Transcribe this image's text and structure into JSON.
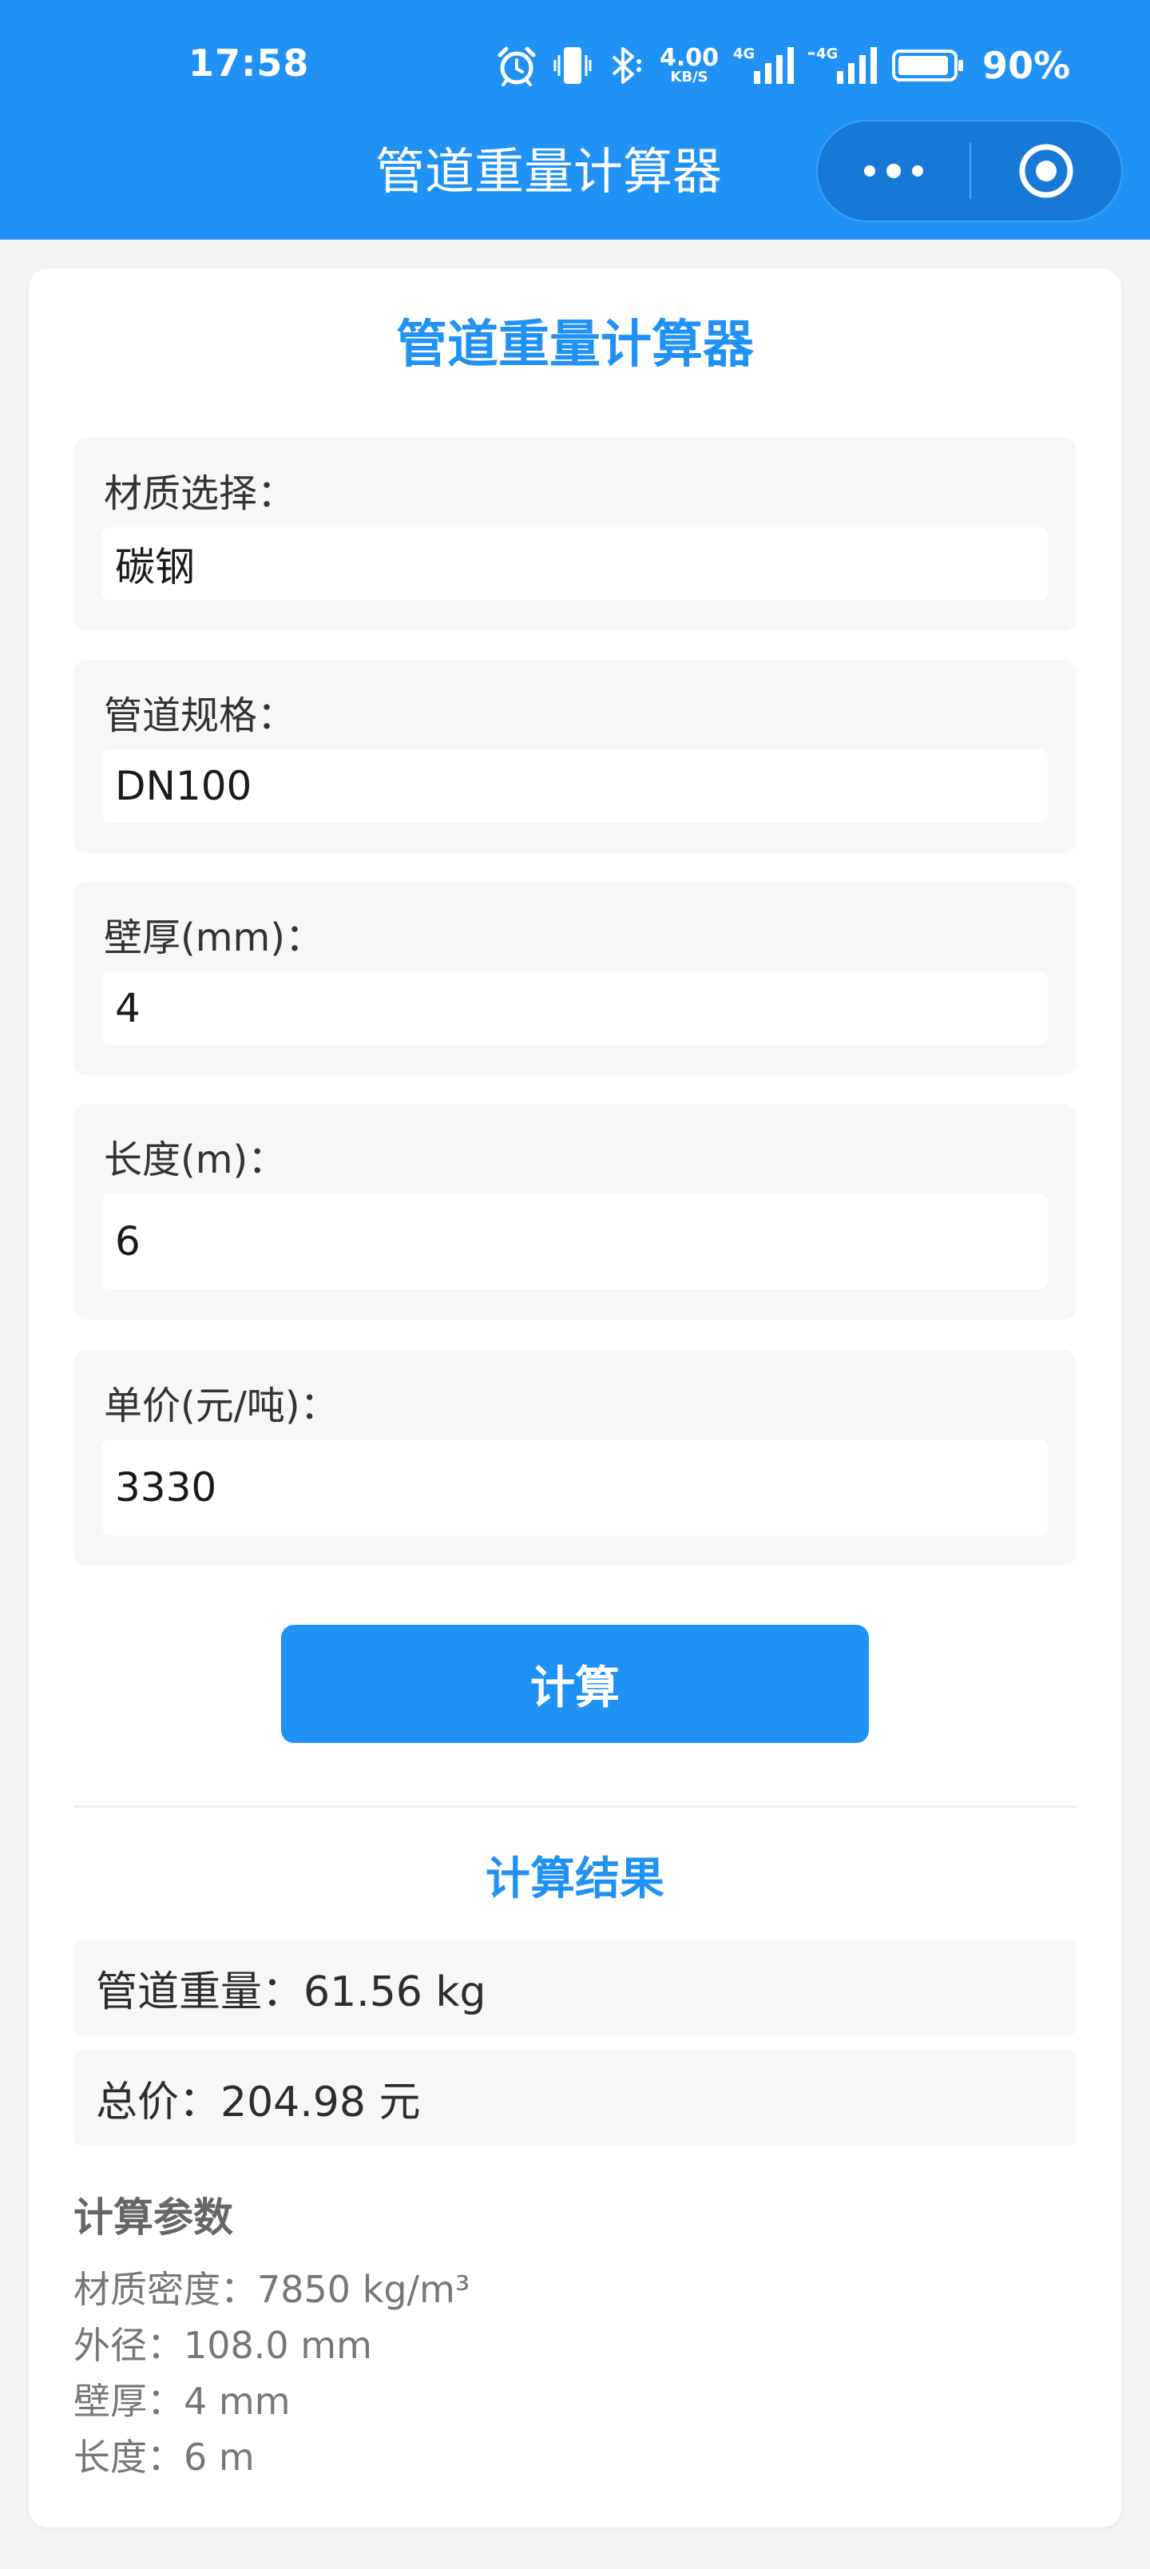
{
  "status_bar": {
    "time": "17:58",
    "net_speed_value": "4.00",
    "net_speed_unit": "KB/S",
    "signal1_label": "4G",
    "signal2_label": "4G",
    "battery": "90%"
  },
  "nav": {
    "title": "管道重量计算器",
    "more_icon": "more-dots-icon",
    "close_icon": "target-circle-icon"
  },
  "page": {
    "title": "管道重量计算器"
  },
  "form": {
    "fields": [
      {
        "label": "材质选择：",
        "value": "碳钢"
      },
      {
        "label": "管道规格：",
        "value": "DN100"
      },
      {
        "label": "壁厚(mm)：",
        "value": "4"
      },
      {
        "label": "长度(m)：",
        "value": "6"
      },
      {
        "label": "单价(元/吨)：",
        "value": "3330"
      }
    ],
    "calc_button": "计算"
  },
  "results": {
    "title": "计算结果",
    "weight": "管道重量：61.56 kg",
    "total": "总价：204.98 元"
  },
  "params": {
    "title": "计算参数",
    "items": [
      "材质密度：7850 kg/m³",
      "外径：108.0 mm",
      "壁厚：4 mm",
      "长度：6 m"
    ]
  },
  "colors": {
    "brand": "#2192f5",
    "background": "#f4f4f4"
  }
}
